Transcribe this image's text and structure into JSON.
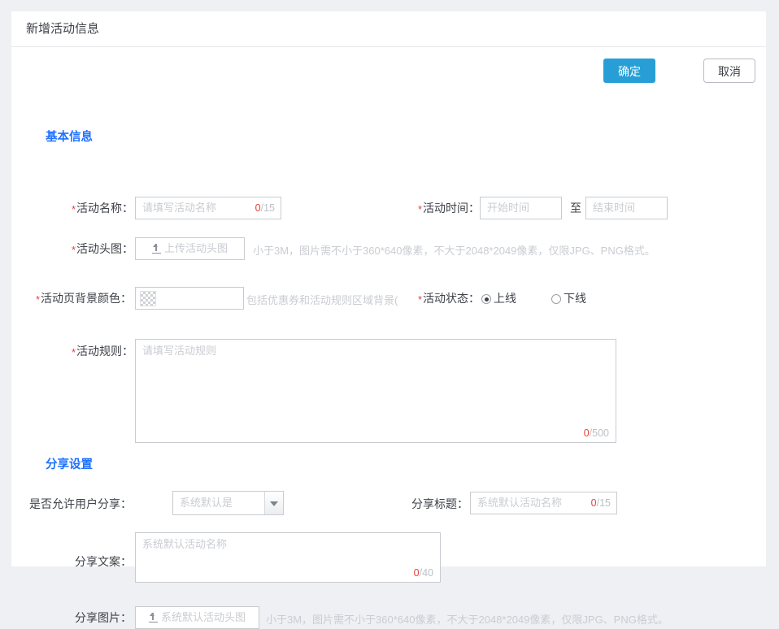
{
  "card": {
    "title": "新增活动信息"
  },
  "toolbar": {
    "confirm_label": "确定",
    "cancel_label": "取消"
  },
  "sections": {
    "basic": {
      "title": "基本信息",
      "activity_name": {
        "label": "活动名称：",
        "required": "*",
        "placeholder": "请填写活动名称",
        "count": "0",
        "max": "/15"
      },
      "activity_time": {
        "label": "活动时间：",
        "required": "*",
        "start_placeholder": "开始时间",
        "separator": "至",
        "end_placeholder": "结束时间"
      },
      "activity_banner": {
        "label": "活动头图：",
        "required": "*",
        "upload_label": "上传活动头图",
        "hint": "小于3M，图片需不小于360*640像素，不大于2048*2049像素，仅限JPG、PNG格式。"
      },
      "page_bg_color": {
        "label": "活动页背景颜色：",
        "required": "*",
        "value": "",
        "hint": "包括优惠券和活动规则区域背景("
      },
      "activity_status": {
        "label": "活动状态：",
        "required": "*",
        "options": [
          {
            "label": "上线",
            "selected": true
          },
          {
            "label": "下线",
            "selected": false
          }
        ]
      },
      "activity_rule": {
        "label": "活动规则：",
        "required": "*",
        "placeholder": "请填写活动规则",
        "count": "0",
        "max": "/500"
      }
    },
    "share": {
      "title": "分享设置",
      "allow_share": {
        "label": "是否允许用户分享：",
        "value": "系统默认是"
      },
      "share_title": {
        "label": "分享标题：",
        "placeholder": "系统默认活动名称",
        "count": "0",
        "max": "/15"
      },
      "share_copy": {
        "label": "分享文案：",
        "placeholder": "系统默认活动名称",
        "count": "0",
        "max": "/40"
      },
      "share_image": {
        "label": "分享图片：",
        "upload_label": "系统默认活动头图",
        "hint": "小于3M，图片需不小于360*640像素，不大于2048*2049像素，仅限JPG、PNG格式。"
      }
    }
  },
  "colors": {
    "accent": "#1f72ff",
    "primary_button": "#279fd6",
    "required_mark": "#e8413c",
    "page_background": "#eff0f4"
  }
}
